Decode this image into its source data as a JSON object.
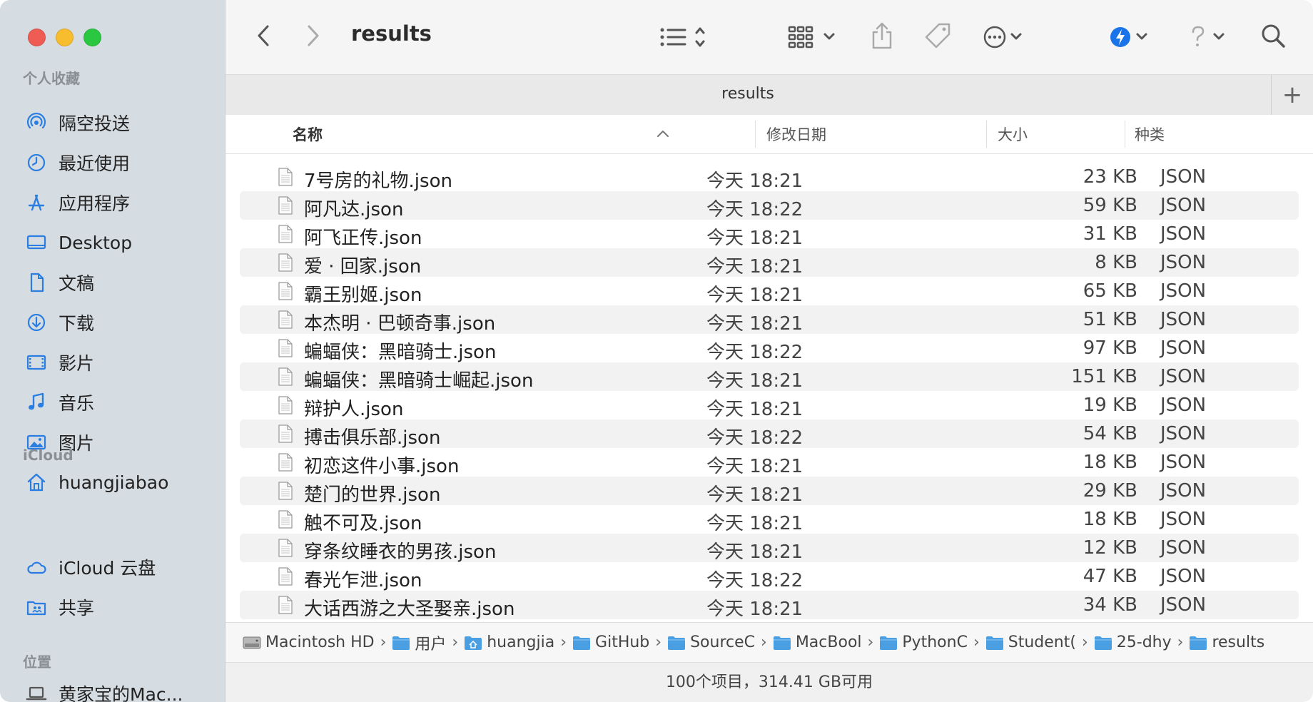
{
  "window": {
    "title": "results",
    "tab_title": "results",
    "tab_plus": "+"
  },
  "sidebar": {
    "sections": {
      "favorites": "个人收藏",
      "icloud": "iCloud",
      "locations": "位置"
    },
    "favorites": [
      {
        "label": "隔空投送",
        "icon": "airdrop-icon"
      },
      {
        "label": "最近使用",
        "icon": "clock-icon"
      },
      {
        "label": "应用程序",
        "icon": "applications-icon"
      },
      {
        "label": "Desktop",
        "icon": "desktop-icon"
      },
      {
        "label": "文稿",
        "icon": "document-icon"
      },
      {
        "label": "下载",
        "icon": "download-icon"
      },
      {
        "label": "影片",
        "icon": "film-icon"
      },
      {
        "label": "音乐",
        "icon": "music-icon"
      },
      {
        "label": "图片",
        "icon": "photo-icon"
      },
      {
        "label": "huangjiabao",
        "icon": "home-icon"
      }
    ],
    "icloud": [
      {
        "label": "iCloud 云盘",
        "icon": "cloud-icon"
      },
      {
        "label": "共享",
        "icon": "shared-folder-icon"
      }
    ],
    "locations": [
      {
        "label": "黄家宝的Mac...",
        "icon": "laptop-icon"
      }
    ]
  },
  "columns": {
    "name": "名称",
    "date": "修改日期",
    "size": "大小",
    "kind": "种类"
  },
  "files": [
    {
      "name": "7号房的礼物.json",
      "date": "今天 18:21",
      "size": "23 KB",
      "kind": "JSON"
    },
    {
      "name": "阿凡达.json",
      "date": "今天 18:22",
      "size": "59 KB",
      "kind": "JSON"
    },
    {
      "name": "阿飞正传.json",
      "date": "今天 18:21",
      "size": "31 KB",
      "kind": "JSON"
    },
    {
      "name": "爱 · 回家.json",
      "date": "今天 18:21",
      "size": "8 KB",
      "kind": "JSON"
    },
    {
      "name": "霸王别姬.json",
      "date": "今天 18:21",
      "size": "65 KB",
      "kind": "JSON"
    },
    {
      "name": "本杰明 · 巴顿奇事.json",
      "date": "今天 18:21",
      "size": "51 KB",
      "kind": "JSON"
    },
    {
      "name": "蝙蝠侠：黑暗骑士.json",
      "date": "今天 18:22",
      "size": "97 KB",
      "kind": "JSON"
    },
    {
      "name": "蝙蝠侠：黑暗骑士崛起.json",
      "date": "今天 18:21",
      "size": "151 KB",
      "kind": "JSON"
    },
    {
      "name": "辩护人.json",
      "date": "今天 18:21",
      "size": "19 KB",
      "kind": "JSON"
    },
    {
      "name": "搏击俱乐部.json",
      "date": "今天 18:22",
      "size": "54 KB",
      "kind": "JSON"
    },
    {
      "name": "初恋这件小事.json",
      "date": "今天 18:21",
      "size": "18 KB",
      "kind": "JSON"
    },
    {
      "name": "楚门的世界.json",
      "date": "今天 18:21",
      "size": "29 KB",
      "kind": "JSON"
    },
    {
      "name": "触不可及.json",
      "date": "今天 18:21",
      "size": "18 KB",
      "kind": "JSON"
    },
    {
      "name": "穿条纹睡衣的男孩.json",
      "date": "今天 18:21",
      "size": "12 KB",
      "kind": "JSON"
    },
    {
      "name": "春光乍泄.json",
      "date": "今天 18:22",
      "size": "47 KB",
      "kind": "JSON"
    },
    {
      "name": "大话西游之大圣娶亲.json",
      "date": "今天 18:21",
      "size": "34 KB",
      "kind": "JSON"
    }
  ],
  "path": [
    {
      "label": "Macintosh HD",
      "icon": "hard-drive-icon"
    },
    {
      "label": "用户",
      "icon": "folder-icon"
    },
    {
      "label": "huangjia",
      "icon": "home-folder-icon"
    },
    {
      "label": "GitHub",
      "icon": "folder-icon"
    },
    {
      "label": "SourceC",
      "icon": "folder-icon"
    },
    {
      "label": "MacBool",
      "icon": "folder-icon"
    },
    {
      "label": "PythonC",
      "icon": "folder-icon"
    },
    {
      "label": "Student(",
      "icon": "folder-icon"
    },
    {
      "label": "25-dhy",
      "icon": "folder-icon"
    },
    {
      "label": "results",
      "icon": "folder-icon"
    }
  ],
  "status": "100个项目，314.41 GB可用",
  "colors": {
    "accent": "#1a73e8",
    "sidebar_bg": "#d6dde2",
    "folder": "#4a9fe3"
  }
}
